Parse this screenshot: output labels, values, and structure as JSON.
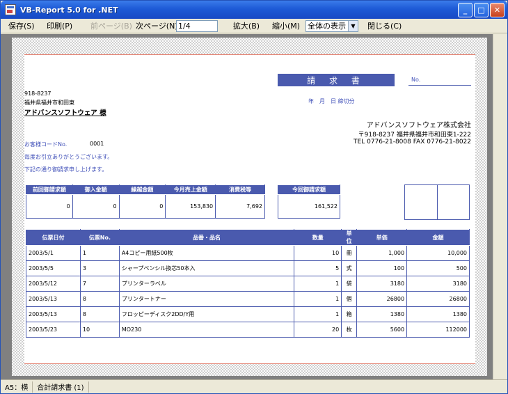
{
  "window": {
    "title": "VB-Report 5.0 for .NET"
  },
  "toolbar": {
    "save": "保存(S)",
    "print": "印刷(P)",
    "prev_page": "前ページ(B)",
    "next_page": "次ページ(N)",
    "page_value": "1/4",
    "zoom_in": "拡大(B)",
    "zoom_out": "縮小(M)",
    "zoom_select": "全体の表示",
    "close": "閉じる(C)"
  },
  "report": {
    "title": "請 求 書",
    "no_label": "No.",
    "date_line": "年　月　日 締切分",
    "customer": {
      "zip": "918-8237",
      "address": "福井県福井市和田東",
      "name": "アドバンスソフトウェア 様"
    },
    "company": {
      "name": "アドバンスソフトウェア株式会社",
      "address": "〒918-8237 福井県福井市和田東1-222",
      "tel": "TEL 0776-21-8008 FAX 0776-21-8022"
    },
    "customer_code_label": "お客様コードNo.",
    "customer_code": "0001",
    "greeting1": "毎度お引立ありがとうございます。",
    "greeting2": "下記の通り御請求申し上げます。",
    "summary": {
      "headers": [
        "前回御請求額",
        "御入金額",
        "繰越金額",
        "今月売上金額",
        "消費税等"
      ],
      "values": [
        "0",
        "0",
        "0",
        "153,830",
        "7,692"
      ],
      "current_label": "今回御請求額",
      "current_value": "161,522"
    },
    "detail": {
      "headers": [
        "伝票日付",
        "伝票No.",
        "品番・品名",
        "数量",
        "単位",
        "単価",
        "金額"
      ],
      "rows": [
        [
          "2003/5/1",
          "1",
          "A4コピー用紙500枚",
          "10",
          "冊",
          "1,000",
          "10,000"
        ],
        [
          "2003/5/5",
          "3",
          "シャープペンシル換芯50本入",
          "5",
          "式",
          "100",
          "500"
        ],
        [
          "2003/5/12",
          "7",
          "プリンターラベル",
          "1",
          "袋",
          "3180",
          "3180"
        ],
        [
          "2003/5/13",
          "8",
          "プリンタートナー",
          "1",
          "個",
          "26800",
          "26800"
        ],
        [
          "2003/5/13",
          "8",
          "フロッピーディスク2DD/Y用",
          "1",
          "箱",
          "1380",
          "1380"
        ],
        [
          "2003/5/23",
          "10",
          "MO230",
          "20",
          "枚",
          "5600",
          "112000"
        ]
      ]
    }
  },
  "status": {
    "paper": "A5：横",
    "doc": "合計請求書 (1)"
  },
  "colors": {
    "accent": "#4a5aae",
    "titlebar": "#1d5ad6"
  }
}
